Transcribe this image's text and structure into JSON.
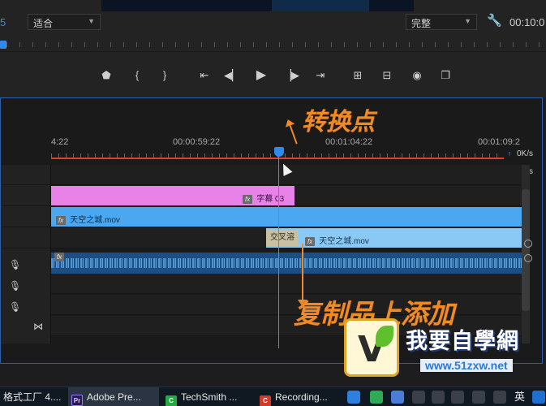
{
  "monitor": {
    "timecode_left": "5",
    "fit_select": "适合",
    "quality_select": "完整",
    "timecode_right": "00:10:0"
  },
  "transport": {
    "buttons": [
      {
        "name": "add-marker-icon",
        "glyph": "⬟"
      },
      {
        "name": "mark-in-icon",
        "glyph": "{"
      },
      {
        "name": "mark-out-icon",
        "glyph": "}"
      },
      {
        "name": "go-to-in-icon",
        "glyph": "⇤"
      },
      {
        "name": "step-back-icon",
        "glyph": "◀▏"
      },
      {
        "name": "play-icon",
        "glyph": "▶"
      },
      {
        "name": "step-forward-icon",
        "glyph": "▕▶"
      },
      {
        "name": "go-to-out-icon",
        "glyph": "⇥"
      },
      {
        "name": "lift-icon",
        "glyph": "⊞"
      },
      {
        "name": "extract-icon",
        "glyph": "⊟"
      },
      {
        "name": "export-frame-icon",
        "glyph": "◉"
      },
      {
        "name": "compare-icon",
        "glyph": "❐"
      }
    ]
  },
  "timeline": {
    "ruler_labels": [
      "4:22",
      "00:00:59:22",
      "00:01:04:22",
      "00:01:09:2"
    ],
    "stats": [
      {
        "arrow": "↑",
        "value": "0K/s"
      },
      {
        "arrow": "↓",
        "value": "0K/s"
      }
    ],
    "clips": {
      "title_clip": "字幕 03",
      "video_a": "天空之城.mov",
      "video_b": "天空之城.mov",
      "cross_dissolve": "交叉溶",
      "fx": "fx"
    },
    "track_icons": {
      "mic": "🎙",
      "bowtie": "⋈"
    }
  },
  "annotations": {
    "top": "转换点",
    "bottom": "复制品上添加"
  },
  "watermark": {
    "brand": "我要自學網",
    "url": "www.51zxw.net"
  },
  "taskbar": {
    "items": [
      {
        "label": "格式工厂 4....",
        "icon": ""
      },
      {
        "label": "Adobe Pre...",
        "icon": "Pr"
      },
      {
        "label": "TechSmith ...",
        "icon": "C"
      },
      {
        "label": "Recording...",
        "icon": "C"
      }
    ],
    "ime": "英"
  }
}
